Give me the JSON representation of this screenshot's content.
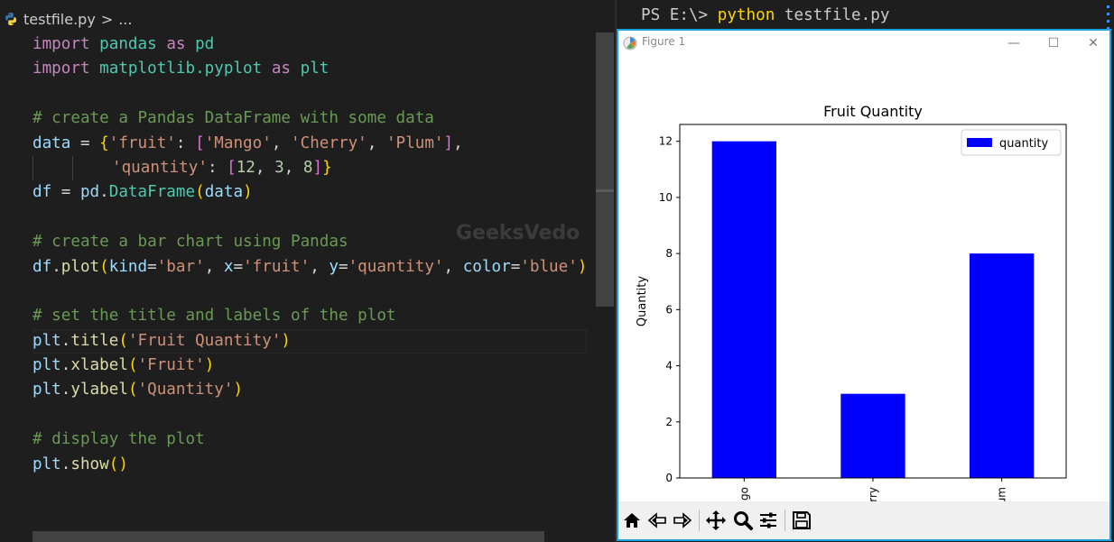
{
  "editor": {
    "breadcrumb": {
      "file": "testfile.py",
      "sep": ">",
      "more": "..."
    },
    "watermark": "GeeksVedo",
    "lines": [
      [
        [
          "kw",
          "import"
        ],
        [
          "t",
          " "
        ],
        [
          "mod",
          "pandas"
        ],
        [
          "t",
          " "
        ],
        [
          "kw",
          "as"
        ],
        [
          "t",
          " "
        ],
        [
          "mod",
          "pd"
        ]
      ],
      [
        [
          "kw",
          "import"
        ],
        [
          "t",
          " "
        ],
        [
          "mod",
          "matplotlib.pyplot"
        ],
        [
          "t",
          " "
        ],
        [
          "kw",
          "as"
        ],
        [
          "t",
          " "
        ],
        [
          "mod",
          "plt"
        ]
      ],
      [],
      [
        [
          "cmt",
          "# create a Pandas DataFrame with some data"
        ]
      ],
      [
        [
          "var",
          "data"
        ],
        [
          "t",
          " = "
        ],
        [
          "b1",
          "{"
        ],
        [
          "str",
          "'fruit'"
        ],
        [
          "t",
          ": "
        ],
        [
          "b2",
          "["
        ],
        [
          "str",
          "'Mango'"
        ],
        [
          "t",
          ", "
        ],
        [
          "str",
          "'Cherry'"
        ],
        [
          "t",
          ", "
        ],
        [
          "str",
          "'Plum'"
        ],
        [
          "b2",
          "]"
        ],
        [
          "t",
          ","
        ]
      ],
      [
        [
          "guide",
          ""
        ],
        [
          "guide",
          ""
        ],
        [
          "str",
          "'quantity'"
        ],
        [
          "t",
          ": "
        ],
        [
          "b2",
          "["
        ],
        [
          "num",
          "12"
        ],
        [
          "t",
          ", "
        ],
        [
          "num",
          "3"
        ],
        [
          "t",
          ", "
        ],
        [
          "num",
          "8"
        ],
        [
          "b2",
          "]"
        ],
        [
          "b1",
          "}"
        ]
      ],
      [
        [
          "var",
          "df"
        ],
        [
          "t",
          " = "
        ],
        [
          "var",
          "pd"
        ],
        [
          "t",
          "."
        ],
        [
          "mod",
          "DataFrame"
        ],
        [
          "b1",
          "("
        ],
        [
          "var",
          "data"
        ],
        [
          "b1",
          ")"
        ]
      ],
      [],
      [
        [
          "cmt",
          "# create a bar chart using Pandas"
        ]
      ],
      [
        [
          "var",
          "df"
        ],
        [
          "t",
          "."
        ],
        [
          "fn",
          "plot"
        ],
        [
          "b1",
          "("
        ],
        [
          "var",
          "kind"
        ],
        [
          "t",
          "="
        ],
        [
          "str",
          "'bar'"
        ],
        [
          "t",
          ", "
        ],
        [
          "var",
          "x"
        ],
        [
          "t",
          "="
        ],
        [
          "str",
          "'fruit'"
        ],
        [
          "t",
          ", "
        ],
        [
          "var",
          "y"
        ],
        [
          "t",
          "="
        ],
        [
          "str",
          "'quantity'"
        ],
        [
          "t",
          ", "
        ],
        [
          "var",
          "color"
        ],
        [
          "t",
          "="
        ],
        [
          "str",
          "'blue'"
        ],
        [
          "b1",
          ")"
        ]
      ],
      [],
      [
        [
          "cmt",
          "# set the title and labels of the plot"
        ]
      ],
      [
        [
          "var",
          "plt"
        ],
        [
          "t",
          "."
        ],
        [
          "fn",
          "title"
        ],
        [
          "b1",
          "("
        ],
        [
          "str",
          "'Fruit Quantity'"
        ],
        [
          "b1",
          ")"
        ]
      ],
      [
        [
          "var",
          "plt"
        ],
        [
          "t",
          "."
        ],
        [
          "fn",
          "xlabel"
        ],
        [
          "b1",
          "("
        ],
        [
          "str",
          "'Fruit'"
        ],
        [
          "b1",
          ")"
        ]
      ],
      [
        [
          "var",
          "plt"
        ],
        [
          "t",
          "."
        ],
        [
          "fn",
          "ylabel"
        ],
        [
          "b1",
          "("
        ],
        [
          "str",
          "'Quantity'"
        ],
        [
          "b1",
          ")"
        ]
      ],
      [],
      [
        [
          "cmt",
          "# display the plot"
        ]
      ],
      [
        [
          "var",
          "plt"
        ],
        [
          "t",
          "."
        ],
        [
          "fn",
          "show"
        ],
        [
          "b1",
          "()"
        ]
      ]
    ]
  },
  "terminal": {
    "prompt": "PS E:\\> ",
    "command": "python",
    "args": " testfile.py"
  },
  "figure_window": {
    "title": "Figure 1",
    "minimize": "—",
    "maximize": "☐",
    "close": "✕",
    "toolbar": [
      "home-icon",
      "back-icon",
      "forward-icon",
      "pan-icon",
      "zoom-icon",
      "configure-icon",
      "save-icon"
    ]
  },
  "chart_data": {
    "type": "bar",
    "title": "Fruit Quantity",
    "xlabel": "",
    "ylabel": "Quantity",
    "categories": [
      "Mango",
      "Cherry",
      "Plum"
    ],
    "series": [
      {
        "name": "quantity",
        "values": [
          12,
          3,
          8
        ],
        "color": "#0000ff"
      }
    ],
    "ylim": [
      0,
      12.6
    ],
    "yticks": [
      0,
      2,
      4,
      6,
      8,
      10,
      12
    ],
    "legend": "top-right",
    "grid": false
  }
}
